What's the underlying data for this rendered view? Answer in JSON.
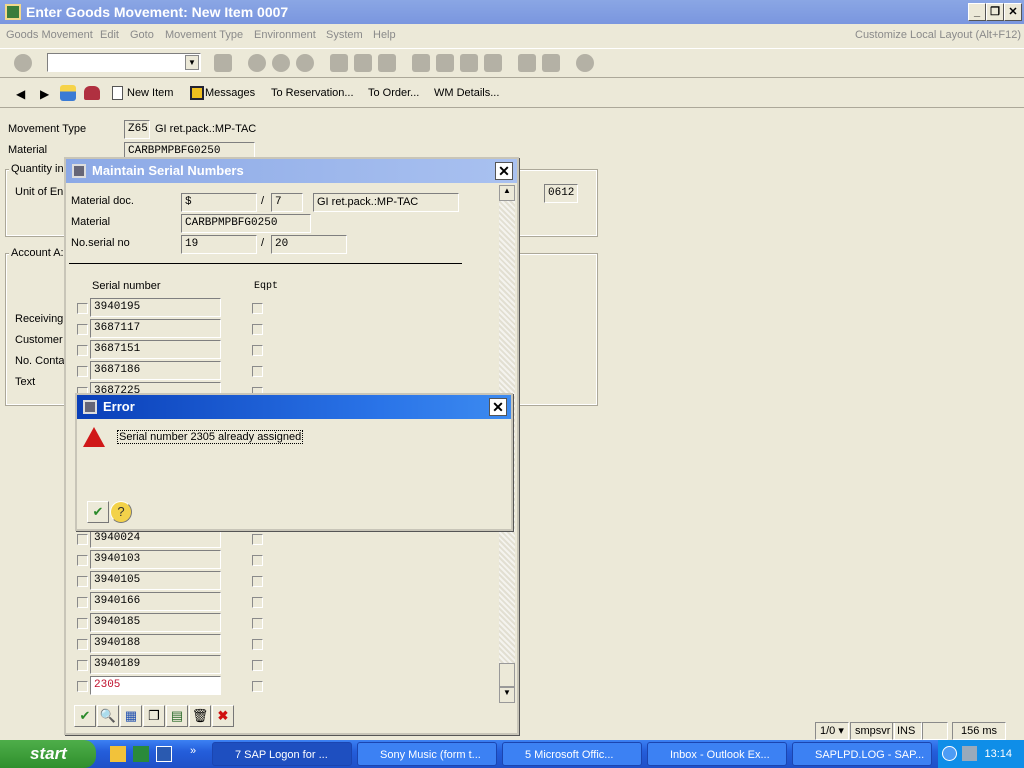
{
  "window": {
    "title": "Enter Goods Movement: New Item 0007",
    "min": "_",
    "restore": "❐",
    "close": "✕"
  },
  "menu": {
    "items": [
      "Goods Movement",
      "Edit",
      "Goto",
      "Movement Type",
      "Environment",
      "System",
      "Help"
    ],
    "customize": "Customize Local Layout (Alt+F12)"
  },
  "toolbar": {
    "command_field": "",
    "icons": [
      "enter-icon",
      "save-icon",
      "back-icon",
      "exit-icon",
      "cancel-icon",
      "print-icon",
      "find-icon",
      "find-next-icon",
      "first-page-icon",
      "previous-page-icon",
      "next-page-icon",
      "last-page-icon",
      "create-session-icon",
      "shortcut-icon",
      "help-icon"
    ]
  },
  "app_toolbar": {
    "new_item": "New Item",
    "messages": "Messages",
    "to_reservation": "To Reservation...",
    "to_order": "To Order...",
    "wm_details": "WM Details..."
  },
  "form": {
    "movement_type_label": "Movement Type",
    "movement_type": "Z65",
    "movement_type_text": "GI ret.pack.:MP-TAC",
    "material_label": "Material",
    "material": "CARBPMPBFG0250",
    "quantity_group": "Quantity in",
    "unit_label": "Unit of En",
    "plant_value": "0612",
    "account_group": "Account A:",
    "receiving": "Receiving",
    "customer": "Customer",
    "no_conta": "No. Conta",
    "text": "Text"
  },
  "serial_dialog": {
    "title": "Maintain Serial Numbers",
    "material_doc_label": "Material doc.",
    "material_doc": "$",
    "slash": "/",
    "item": "7",
    "movement_text": "GI ret.pack.:MP-TAC",
    "material_label": "Material",
    "material": "CARBPMPBFG0250",
    "no_serial_label": "No.serial no",
    "no_serial": "19",
    "no_serial_total": "20",
    "col_serial": "Serial number",
    "col_eqpt": "Eqpt",
    "serials_top": [
      "3940195",
      "3687117",
      "3687151",
      "3687186",
      "3687225"
    ],
    "serials_bottom": [
      "3940024",
      "3940103",
      "3940105",
      "3940166",
      "3940185",
      "3940188",
      "3940189",
      "2305"
    ],
    "error_color": "#c0102c"
  },
  "error_dialog": {
    "title": "Error",
    "message": "Serial number 2305 already assigned"
  },
  "status": {
    "session": "1/0",
    "server": "smpsvr",
    "mode": "INS",
    "time": "156 ms"
  },
  "taskbar": {
    "start": "start",
    "items": [
      "7 SAP Logon for ...",
      "Sony Music (form t...",
      "5 Microsoft Offic...",
      "Inbox - Outlook Ex...",
      "SAPLPD.LOG - SAP..."
    ],
    "clock": "13:14"
  }
}
